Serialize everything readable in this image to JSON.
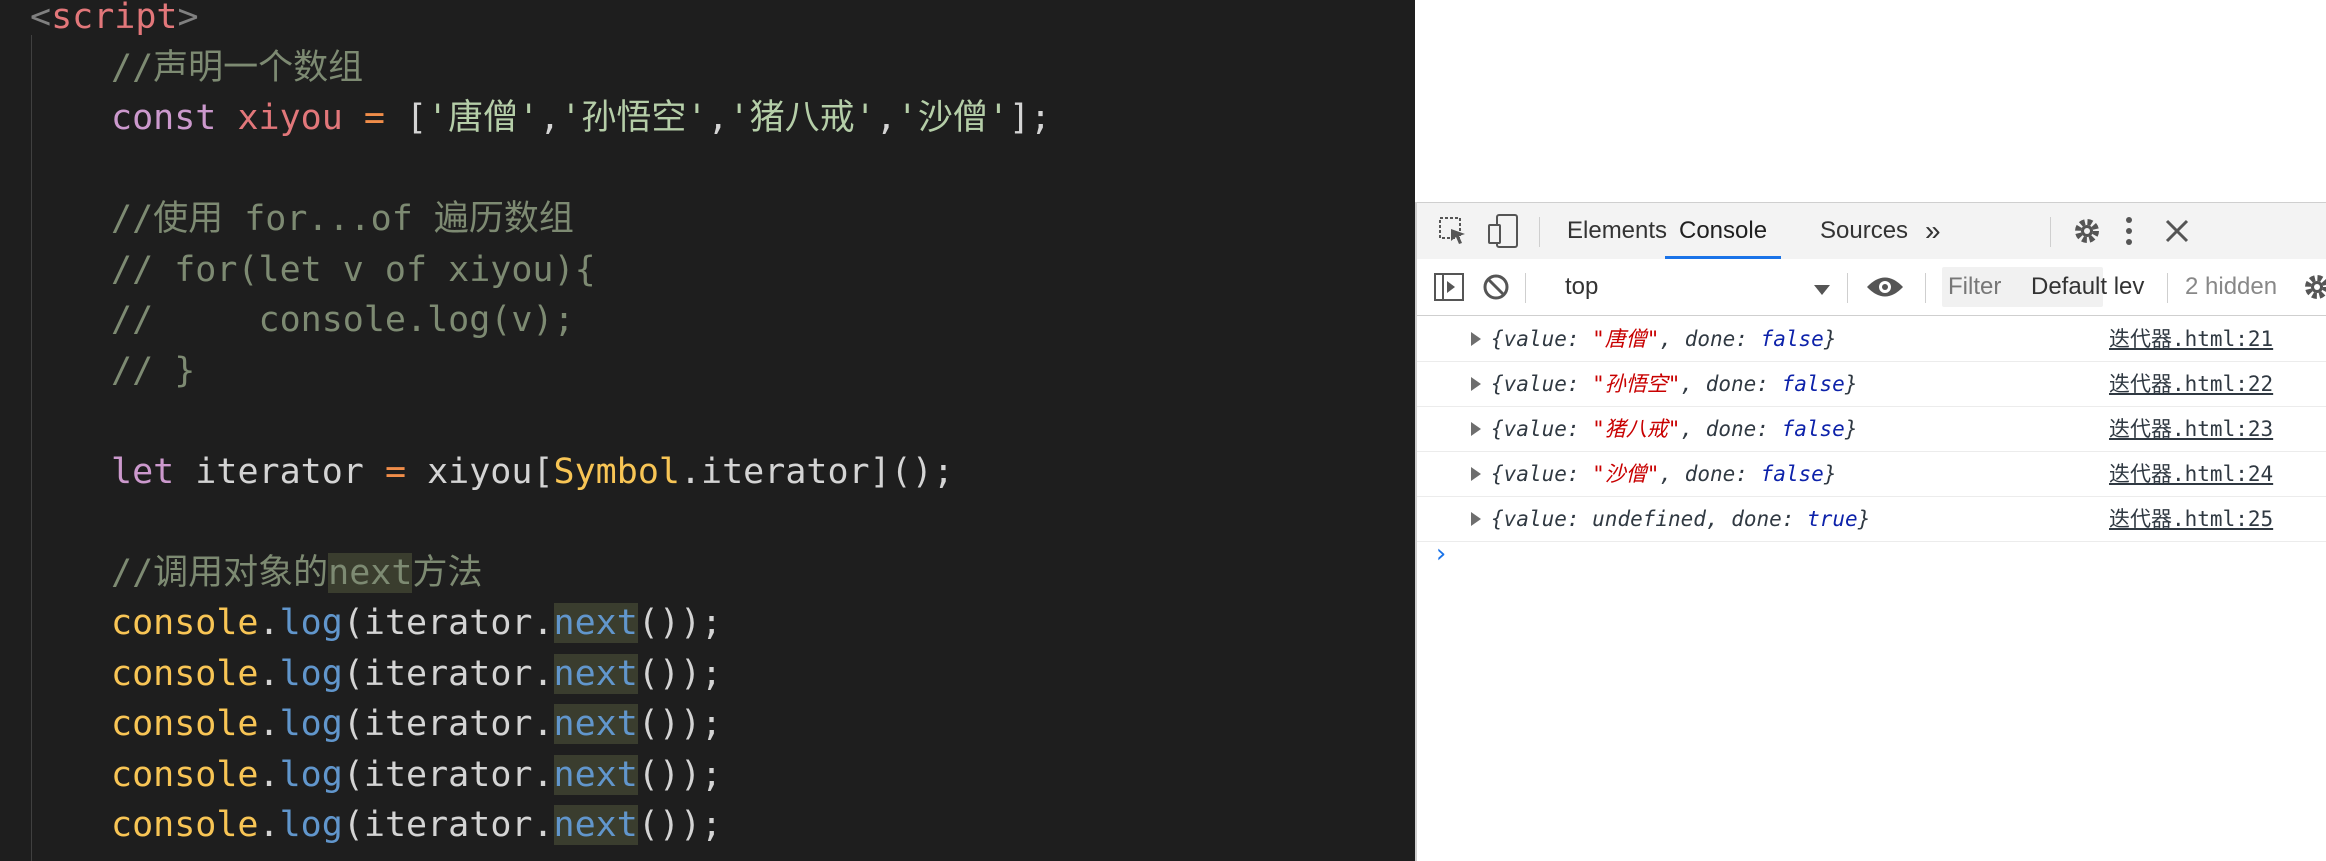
{
  "editor": {
    "lines": [
      {
        "seg": [
          {
            "t": "<",
            "c": "c-tag"
          },
          {
            "t": "script",
            "c": "c-tagname"
          },
          {
            "t": ">",
            "c": "c-tag"
          }
        ],
        "indent": 30
      },
      {
        "seg": [
          {
            "t": "//声明一个数组",
            "c": "c-comment2"
          }
        ],
        "indent": 111
      },
      {
        "seg": [
          {
            "t": "const ",
            "c": "c-kw"
          },
          {
            "t": "xiyou",
            "c": "c-var"
          },
          {
            "t": " = ",
            "c": "c-op"
          },
          {
            "t": "[",
            "c": "c-punc"
          },
          {
            "t": "'唐僧'",
            "c": "c-str"
          },
          {
            "t": ",",
            "c": "c-punc"
          },
          {
            "t": "'孙悟空'",
            "c": "c-str"
          },
          {
            "t": ",",
            "c": "c-punc"
          },
          {
            "t": "'猪八戒'",
            "c": "c-str"
          },
          {
            "t": ",",
            "c": "c-punc"
          },
          {
            "t": "'沙僧'",
            "c": "c-str"
          },
          {
            "t": "];",
            "c": "c-punc"
          }
        ],
        "indent": 111
      },
      {
        "seg": [],
        "indent": 111
      },
      {
        "seg": [
          {
            "t": "//使用 for...of 遍历数组",
            "c": "c-comment2"
          }
        ],
        "indent": 111
      },
      {
        "seg": [
          {
            "t": "// for(let v of xiyou){",
            "c": "c-comment2"
          }
        ],
        "indent": 111
      },
      {
        "seg": [
          {
            "t": "//     console.log(v);",
            "c": "c-comment2"
          }
        ],
        "indent": 111
      },
      {
        "seg": [
          {
            "t": "// }",
            "c": "c-comment2"
          }
        ],
        "indent": 111
      },
      {
        "seg": [],
        "indent": 111
      },
      {
        "seg": [
          {
            "t": "let ",
            "c": "c-kw"
          },
          {
            "t": "iterator",
            "c": "c-punc"
          },
          {
            "t": " = ",
            "c": "c-op"
          },
          {
            "t": "xiyou[",
            "c": "c-punc"
          },
          {
            "t": "Symbol",
            "c": "c-cls"
          },
          {
            "t": ".iterator](",
            "c": "c-punc"
          },
          {
            "t": ");",
            "c": "c-punc"
          }
        ],
        "indent": 111
      },
      {
        "seg": [],
        "indent": 111
      },
      {
        "seg": [
          {
            "t": "//调用对象的",
            "c": "c-comment2"
          },
          {
            "t": "next",
            "c": "c-comment2 c-hl"
          },
          {
            "t": "方法",
            "c": "c-comment2"
          }
        ],
        "indent": 111
      },
      {
        "seg": [
          {
            "t": "console",
            "c": "c-obj"
          },
          {
            "t": ".",
            "c": "c-punc"
          },
          {
            "t": "log",
            "c": "c-fn"
          },
          {
            "t": "(iterator.",
            "c": "c-punc"
          },
          {
            "t": "next",
            "c": "c-fn c-hl"
          },
          {
            "t": "());",
            "c": "c-punc"
          }
        ],
        "indent": 111
      },
      {
        "seg": [
          {
            "t": "console",
            "c": "c-obj"
          },
          {
            "t": ".",
            "c": "c-punc"
          },
          {
            "t": "log",
            "c": "c-fn"
          },
          {
            "t": "(iterator.",
            "c": "c-punc"
          },
          {
            "t": "next",
            "c": "c-fn c-hl"
          },
          {
            "t": "());",
            "c": "c-punc"
          }
        ],
        "indent": 111
      },
      {
        "seg": [
          {
            "t": "console",
            "c": "c-obj"
          },
          {
            "t": ".",
            "c": "c-punc"
          },
          {
            "t": "log",
            "c": "c-fn"
          },
          {
            "t": "(iterator.",
            "c": "c-punc"
          },
          {
            "t": "next",
            "c": "c-fn c-hl"
          },
          {
            "t": "());",
            "c": "c-punc"
          }
        ],
        "indent": 111
      },
      {
        "seg": [
          {
            "t": "console",
            "c": "c-obj"
          },
          {
            "t": ".",
            "c": "c-punc"
          },
          {
            "t": "log",
            "c": "c-fn"
          },
          {
            "t": "(iterator.",
            "c": "c-punc"
          },
          {
            "t": "next",
            "c": "c-fn c-hl"
          },
          {
            "t": "());",
            "c": "c-punc"
          }
        ],
        "indent": 111
      },
      {
        "seg": [
          {
            "t": "console",
            "c": "c-obj"
          },
          {
            "t": ".",
            "c": "c-punc"
          },
          {
            "t": "log",
            "c": "c-fn"
          },
          {
            "t": "(iterator.",
            "c": "c-punc"
          },
          {
            "t": "next",
            "c": "c-fn c-hl"
          },
          {
            "t": "());",
            "c": "c-punc"
          }
        ],
        "indent": 111
      }
    ]
  },
  "devtools": {
    "tabs": {
      "elements": "Elements",
      "console": "Console",
      "sources": "Sources",
      "more": "»"
    },
    "toolbar": {
      "context": "top",
      "filter_placeholder": "Filter",
      "levels": "Default lev",
      "hidden": "2 hidden"
    },
    "logs": [
      {
        "pre": "{value: ",
        "val": "\"唐僧\"",
        "mid": ", done: ",
        "done": "false",
        "post": "}",
        "src": "迭代器.html:21"
      },
      {
        "pre": "{value: ",
        "val": "\"孙悟空\"",
        "mid": ", done: ",
        "done": "false",
        "post": "}",
        "src": "迭代器.html:22"
      },
      {
        "pre": "{value: ",
        "val": "\"猪八戒\"",
        "mid": ", done: ",
        "done": "false",
        "post": "}",
        "src": "迭代器.html:23"
      },
      {
        "pre": "{value: ",
        "val": "\"沙僧\"",
        "mid": ", done: ",
        "done": "false",
        "post": "}",
        "src": "迭代器.html:24"
      },
      {
        "pre": "{value: ",
        "val": "undefined",
        "mid": ", done: ",
        "done": "true",
        "post": "}",
        "src": "迭代器.html:25"
      }
    ],
    "prompt": "›",
    "colors": {
      "accent": "#1a73e8",
      "string": "#c80000",
      "keyword": "#0d22aa"
    }
  }
}
